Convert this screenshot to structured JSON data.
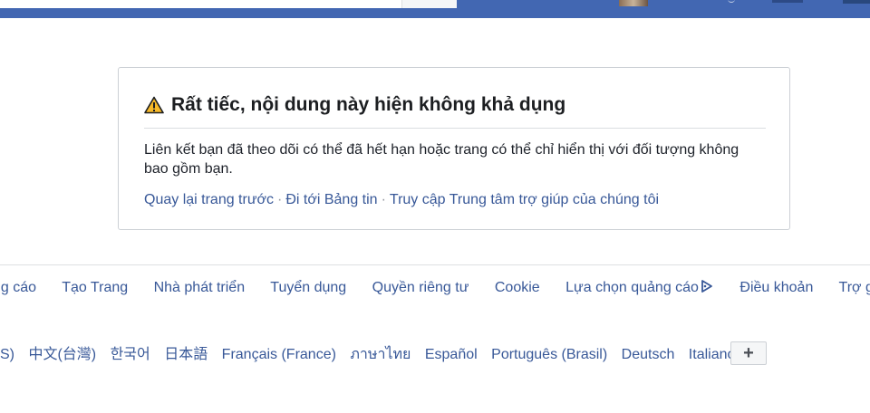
{
  "header": {
    "search_glyph": "/"
  },
  "error_card": {
    "title": "Rất tiếc, nội dung này hiện không khả dụng",
    "message": "Liên kết bạn đã theo dõi có thể đã hết hạn hoặc trang có thể chỉ hiển thị với đối tượng không bao gồm bạn.",
    "links": [
      {
        "label": "Quay lại trang trước"
      },
      {
        "label": "Đi tới Bảng tin"
      },
      {
        "label": "Truy cập Trung tâm trợ giúp của chúng tôi"
      }
    ],
    "separator": "·",
    "warning_icon": "warning-triangle-icon"
  },
  "footer": {
    "links": [
      {
        "label": "ng cáo"
      },
      {
        "label": "Tạo Trang"
      },
      {
        "label": "Nhà phát triển"
      },
      {
        "label": "Tuyển dụng"
      },
      {
        "label": "Quyền riêng tư"
      },
      {
        "label": "Cookie"
      },
      {
        "label": "Lựa chọn quảng cáo"
      },
      {
        "label": "Điều khoản"
      },
      {
        "label": "Trợ g"
      }
    ],
    "adchoices_icon": "adchoices-icon",
    "languages": [
      {
        "label": "JS)"
      },
      {
        "label": "中文(台灣)"
      },
      {
        "label": "한국어"
      },
      {
        "label": "日本語"
      },
      {
        "label": "Français (France)"
      },
      {
        "label": "ภาษาไทย"
      },
      {
        "label": "Español"
      },
      {
        "label": "Português (Brasil)"
      },
      {
        "label": "Deutsch"
      },
      {
        "label": "Italiano"
      }
    ],
    "more_languages_label": "+"
  },
  "colors": {
    "header_blue": "#4267b2",
    "link_blue": "#385898",
    "warning_yellow": "#f7b928"
  }
}
